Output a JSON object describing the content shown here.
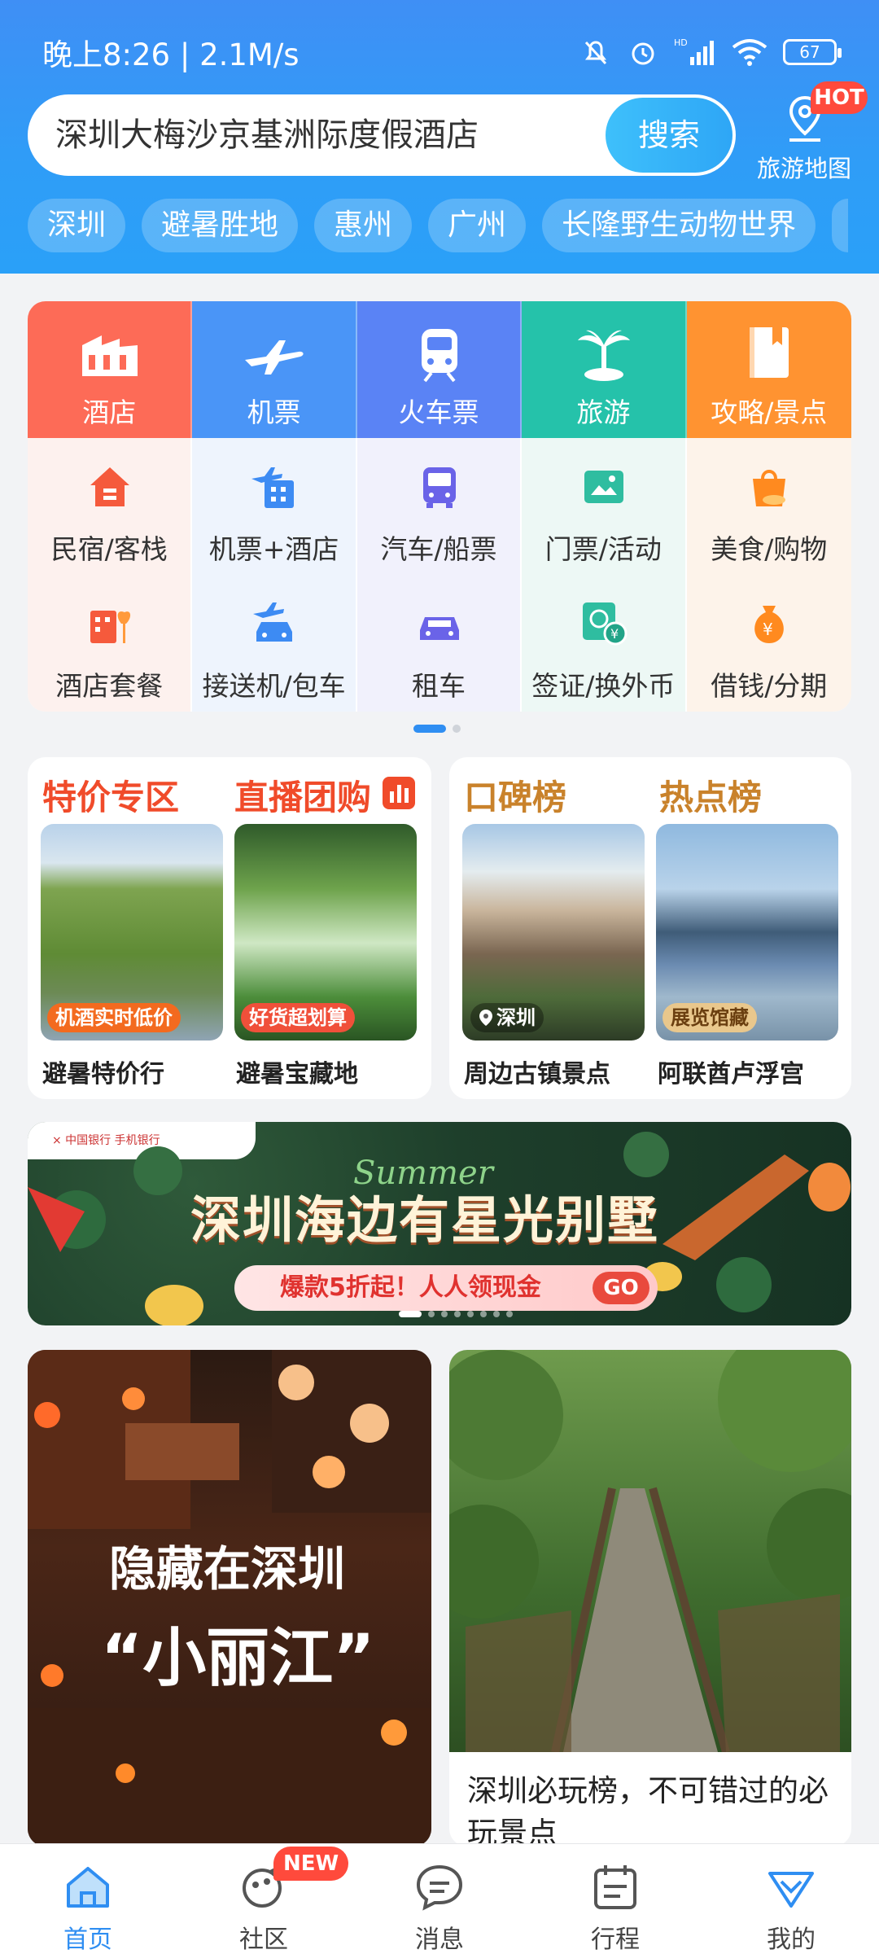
{
  "status_bar": {
    "time": "晚上8:26 | 2.1M/s",
    "battery": "67"
  },
  "search": {
    "query": "深圳大梅沙京基洲际度假酒店",
    "button": "搜索"
  },
  "map": {
    "label": "旅游地图",
    "badge": "HOT"
  },
  "chips": [
    "深圳",
    "避暑胜地",
    "惠州",
    "广州",
    "长隆野生动物世界"
  ],
  "main_tiles": [
    {
      "label": "酒店",
      "icon": "hotel-icon",
      "color": "#fd6b57"
    },
    {
      "label": "机票",
      "icon": "airplane-icon",
      "color": "#4a95f7"
    },
    {
      "label": "火车票",
      "icon": "train-icon",
      "color": "#5a83f5"
    },
    {
      "label": "旅游",
      "icon": "palm-tree-icon",
      "color": "#25c2aa"
    },
    {
      "label": "攻略/景点",
      "icon": "guidebook-icon",
      "color": "#ff9331"
    }
  ],
  "sub_tiles": [
    {
      "label": "民宿/客栈",
      "icon": "house-icon"
    },
    {
      "label": "机票+酒店",
      "icon": "flight-hotel-icon"
    },
    {
      "label": "汽车/船票",
      "icon": "bus-icon"
    },
    {
      "label": "门票/活动",
      "icon": "ticket-icon"
    },
    {
      "label": "美食/购物",
      "icon": "shopping-bag-icon"
    },
    {
      "label": "酒店套餐",
      "icon": "hotel-package-icon"
    },
    {
      "label": "接送机/包车",
      "icon": "airport-transfer-icon"
    },
    {
      "label": "租车",
      "icon": "car-rental-icon"
    },
    {
      "label": "签证/换外币",
      "icon": "visa-currency-icon"
    },
    {
      "label": "借钱/分期",
      "icon": "money-bag-icon"
    }
  ],
  "promo_left": {
    "heading1": "特价专区",
    "heading2": "直播团购",
    "items": [
      {
        "tag": "机酒实时低价",
        "caption": "避暑特价行"
      },
      {
        "tag": "好货超划算",
        "caption": "避暑宝藏地"
      }
    ]
  },
  "promo_right": {
    "heading1": "口碑榜",
    "heading2": "热点榜",
    "items": [
      {
        "tag": "深圳",
        "caption": "周边古镇景点"
      },
      {
        "tag": "展览馆藏",
        "caption": "阿联酋卢浮宫"
      }
    ]
  },
  "banner": {
    "title": "深圳海边有星光别墅",
    "script_word": "Summer",
    "pill": "爆款5折起！人人领现金",
    "go": "GO",
    "partner": "× 中国银行 手机银行"
  },
  "feed": [
    {
      "line1": "隐藏在深圳",
      "line2": "“小丽江”"
    },
    {
      "text": "深圳必玩榜，不可错过的必玩景点"
    }
  ],
  "nav": [
    {
      "label": "首页",
      "icon": "home-icon",
      "active": true
    },
    {
      "label": "社区",
      "icon": "community-icon",
      "badge": "NEW"
    },
    {
      "label": "消息",
      "icon": "message-icon"
    },
    {
      "label": "行程",
      "icon": "itinerary-icon"
    },
    {
      "label": "我的",
      "icon": "profile-icon"
    }
  ],
  "colors": {
    "primary": "#2f8ef2",
    "header": "#3a95f6",
    "promo_red": "#f04b2a",
    "rank_gold": "#c9822b"
  }
}
